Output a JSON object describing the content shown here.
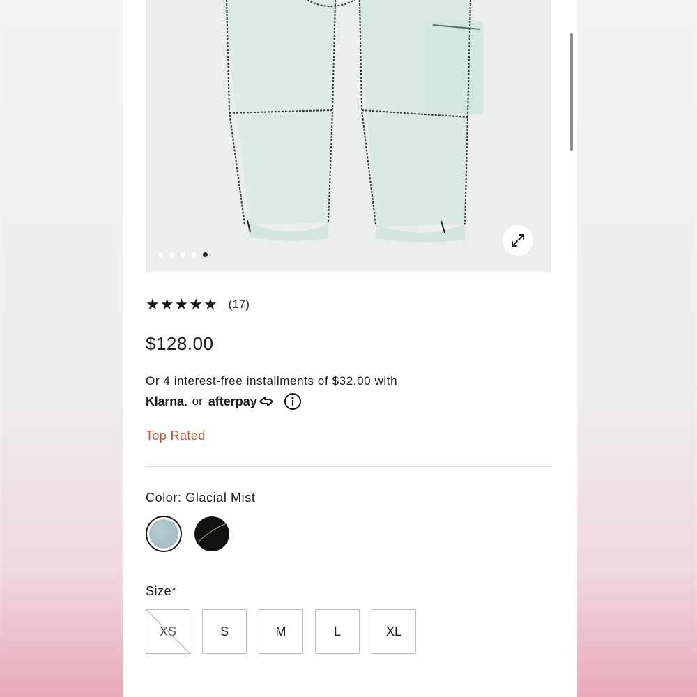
{
  "product": {
    "rating_stars": [
      "★",
      "★",
      "★",
      "★",
      "★"
    ],
    "rating_value": 5,
    "review_count": "(17)",
    "price": "$128.00",
    "installments_text": "Or 4 interest-free installments of $32.00 with",
    "klarna_label": "Klarna.",
    "or_text": "or",
    "afterpay_label": "afterpay",
    "badge": "Top Rated",
    "color_label": "Color: Glacial Mist",
    "size_label": "Size*",
    "sizes": [
      "XS",
      "S",
      "M",
      "L",
      "XL"
    ]
  },
  "carousel": {
    "total_images": 5,
    "active_index": 4
  },
  "colors": {
    "badge": "#b0563c",
    "swatch_selected": "#a8bfc6",
    "swatch_other": "#111111",
    "pants": "#dcebe6"
  },
  "icons": {
    "expand": "expand-icon",
    "info": "info-icon"
  }
}
